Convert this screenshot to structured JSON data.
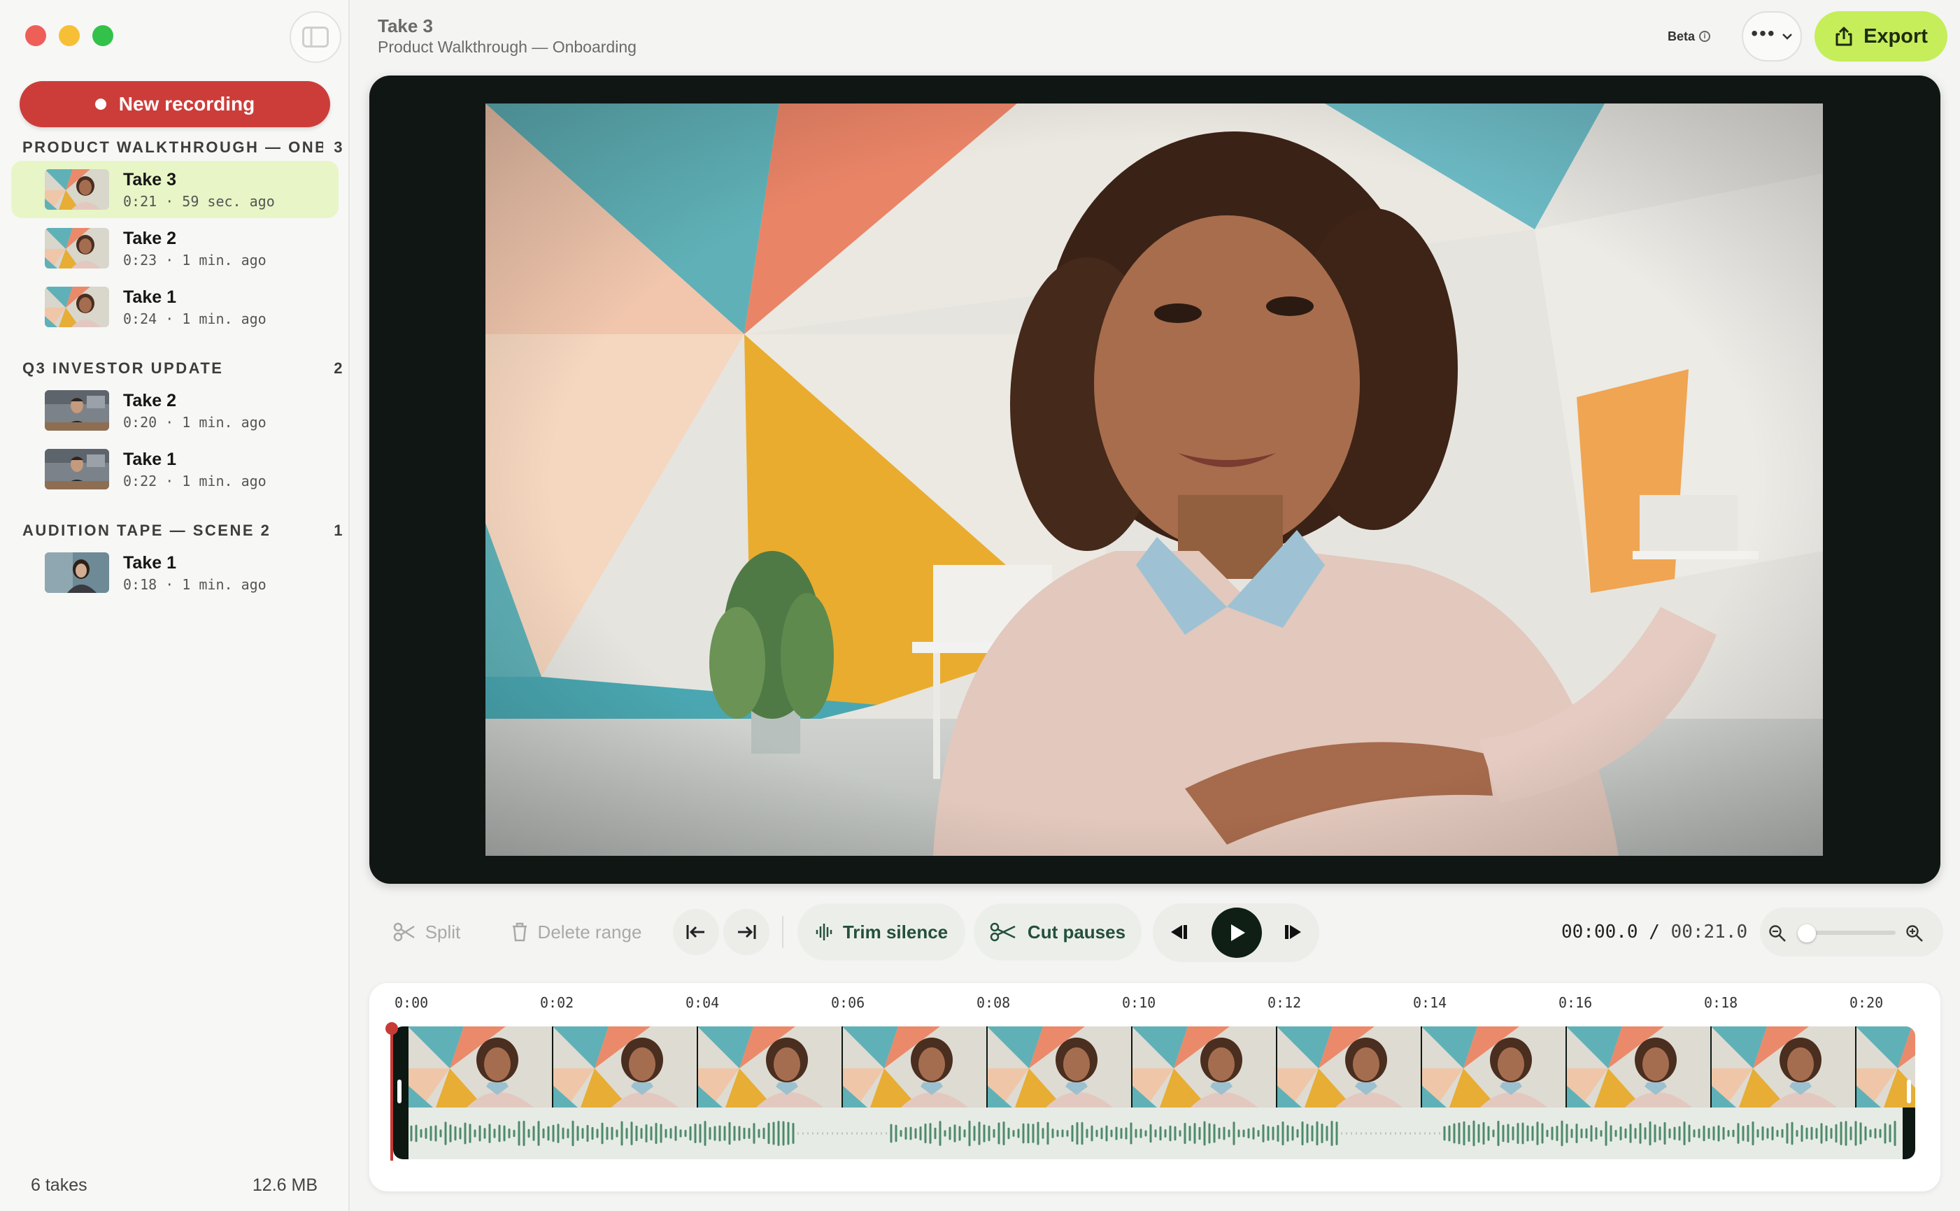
{
  "sidebar": {
    "new_recording_label": "New recording",
    "groups": [
      {
        "name": "PRODUCT WALKTHROUGH — ONB…",
        "count": "3",
        "takes": [
          {
            "title": "Take 3",
            "meta": "0:21 · 59 sec. ago"
          },
          {
            "title": "Take 2",
            "meta": "0:23 · 1 min. ago"
          },
          {
            "title": "Take 1",
            "meta": "0:24 · 1 min. ago"
          }
        ]
      },
      {
        "name": "Q3 INVESTOR UPDATE",
        "count": "2",
        "takes": [
          {
            "title": "Take 2",
            "meta": "0:20 · 1 min. ago"
          },
          {
            "title": "Take 1",
            "meta": "0:22 · 1 min. ago"
          }
        ]
      },
      {
        "name": "AUDITION TAPE — SCENE 2",
        "count": "1",
        "takes": [
          {
            "title": "Take 1",
            "meta": "0:18 · 1 min. ago"
          }
        ]
      }
    ],
    "footer": {
      "takes_count": "6 takes",
      "size": "12.6 MB"
    }
  },
  "header": {
    "title": "Take 3",
    "subtitle": "Product Walkthrough — Onboarding",
    "beta_label": "Beta",
    "export_label": "Export"
  },
  "toolbar": {
    "split_label": "Split",
    "delete_range_label": "Delete range",
    "trim_silence_label": "Trim silence",
    "cut_pauses_label": "Cut pauses",
    "current_time": "00:00.0",
    "separator": "/",
    "total_time": "00:21.0",
    "zoom_level": 0
  },
  "timeline": {
    "ticks": [
      "0:00",
      "0:02",
      "0:04",
      "0:06",
      "0:08",
      "0:10",
      "0:12",
      "0:14",
      "0:16",
      "0:18",
      "0:20"
    ],
    "playhead_position": 0
  },
  "colors": {
    "accent_red": "#cc3d3a",
    "export_green": "#c5ee5a",
    "active_take_bg": "#e8f5c6",
    "dark_green": "#0f1f16",
    "waveform": "#4d8a6a"
  }
}
